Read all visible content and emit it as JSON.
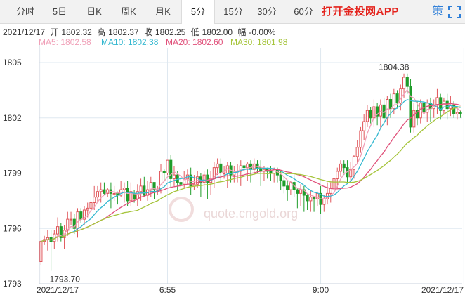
{
  "tabs": [
    {
      "label": "分时",
      "active": false
    },
    {
      "label": "5日",
      "active": false
    },
    {
      "label": "日K",
      "active": false
    },
    {
      "label": "周K",
      "active": false
    },
    {
      "label": "月K",
      "active": false
    },
    {
      "label": "5分",
      "active": true
    },
    {
      "label": "15分",
      "active": false
    },
    {
      "label": "30分",
      "active": false
    },
    {
      "label": "60分",
      "active": false
    }
  ],
  "promo_text": "打开金投网APP",
  "toolbar_icons": [
    "strategy-icon",
    "fullscreen-icon"
  ],
  "toolbar_strategy_label": "策",
  "info": {
    "date": "2021/12/17",
    "open_label": "开",
    "open": "1802.32",
    "high_label": "高",
    "high": "1802.37",
    "close_label": "收",
    "close": "1802.25",
    "low_label": "低",
    "low": "1802.00",
    "change_label": "幅",
    "change": "-0.00%"
  },
  "ma_legend": [
    {
      "label": "MA5: 1802.58",
      "color": "#f0a0b8"
    },
    {
      "label": "MA10: 1802.38",
      "color": "#35b8d0"
    },
    {
      "label": "MA20: 1802.60",
      "color": "#e0507a"
    },
    {
      "label": "MA30: 1801.98",
      "color": "#a5c43a"
    }
  ],
  "watermark": "quote.cngold.org",
  "colors": {
    "up": "#e0555a",
    "down": "#1f9d2a",
    "grid": "#dfe8f0",
    "axis_text": "#333333"
  },
  "chart_data": {
    "type": "candlestick",
    "y_ticks": [
      1793,
      1796,
      1799,
      1802,
      1805
    ],
    "ylim": [
      1793,
      1805.8
    ],
    "x_tick_labels": [
      "2021/12/17",
      "6:55",
      "9:00",
      "2021/12/17"
    ],
    "x_tick_index": [
      0,
      38,
      84,
      127
    ],
    "annotations": [
      {
        "text": "1804.38",
        "index": 109,
        "value": 1804.38
      },
      {
        "text": "1793.70",
        "index": 3,
        "value": 1793.7
      }
    ],
    "candles": [
      [
        1794.2,
        1795.3,
        1794.0,
        1795.4
      ],
      [
        1795.3,
        1795.4,
        1795.1,
        1795.6
      ],
      [
        1795.4,
        1795.5,
        1794.8,
        1795.9
      ],
      [
        1795.5,
        1795.3,
        1793.7,
        1795.9
      ],
      [
        1795.3,
        1795.7,
        1794.9,
        1795.9
      ],
      [
        1795.7,
        1796.1,
        1795.3,
        1796.6
      ],
      [
        1796.1,
        1795.5,
        1795.3,
        1796.3
      ],
      [
        1795.5,
        1795.9,
        1794.9,
        1796.2
      ],
      [
        1795.9,
        1796.5,
        1795.6,
        1796.9
      ],
      [
        1796.5,
        1796.5,
        1796.2,
        1796.9
      ],
      [
        1796.5,
        1796.0,
        1795.7,
        1796.8
      ],
      [
        1796.0,
        1796.9,
        1795.5,
        1797.1
      ],
      [
        1796.9,
        1796.5,
        1796.3,
        1797.1
      ],
      [
        1796.5,
        1797.0,
        1796.2,
        1797.2
      ],
      [
        1797.0,
        1797.1,
        1796.6,
        1797.4
      ],
      [
        1797.1,
        1797.4,
        1796.9,
        1797.7
      ],
      [
        1797.4,
        1797.7,
        1797.0,
        1798.3
      ],
      [
        1797.7,
        1798.0,
        1797.4,
        1798.3
      ],
      [
        1798.0,
        1798.1,
        1797.4,
        1798.5
      ],
      [
        1798.1,
        1797.9,
        1797.8,
        1798.5
      ],
      [
        1797.9,
        1798.1,
        1797.7,
        1798.2
      ],
      [
        1798.1,
        1797.9,
        1797.1,
        1798.5
      ],
      [
        1797.9,
        1797.9,
        1797.5,
        1798.3
      ],
      [
        1797.9,
        1797.8,
        1797.3,
        1798.0
      ],
      [
        1797.8,
        1798.1,
        1797.7,
        1798.6
      ],
      [
        1798.1,
        1798.2,
        1797.4,
        1798.5
      ],
      [
        1798.2,
        1797.5,
        1797.2,
        1798.6
      ],
      [
        1797.5,
        1798.0,
        1797.2,
        1798.5
      ],
      [
        1797.9,
        1797.6,
        1797.4,
        1798.1
      ],
      [
        1797.6,
        1798.0,
        1797.2,
        1798.4
      ],
      [
        1798.0,
        1798.3,
        1797.5,
        1798.7
      ],
      [
        1798.3,
        1797.8,
        1797.7,
        1798.8
      ],
      [
        1797.8,
        1798.1,
        1797.5,
        1798.6
      ],
      [
        1798.1,
        1798.5,
        1797.7,
        1798.8
      ],
      [
        1798.5,
        1798.1,
        1797.6,
        1798.5
      ],
      [
        1798.1,
        1798.1,
        1797.8,
        1798.3
      ],
      [
        1798.1,
        1799.1,
        1797.9,
        1799.5
      ],
      [
        1799.1,
        1799.0,
        1798.6,
        1799.2
      ],
      [
        1799.0,
        1799.7,
        1798.9,
        1799.7
      ],
      [
        1799.7,
        1798.7,
        1798.2,
        1800.0
      ],
      [
        1798.7,
        1798.9,
        1798.3,
        1799.4
      ],
      [
        1798.9,
        1798.5,
        1798.1,
        1799.1
      ],
      [
        1798.5,
        1798.4,
        1798.0,
        1798.8
      ],
      [
        1798.4,
        1798.7,
        1798.2,
        1799.1
      ],
      [
        1798.7,
        1798.9,
        1798.4,
        1799.2
      ],
      [
        1798.9,
        1798.3,
        1797.8,
        1799.3
      ],
      [
        1798.3,
        1798.4,
        1798.1,
        1798.9
      ],
      [
        1798.4,
        1798.8,
        1798.2,
        1799.1
      ],
      [
        1798.8,
        1798.5,
        1797.7,
        1799.0
      ],
      [
        1798.5,
        1798.9,
        1798.1,
        1799.1
      ],
      [
        1798.9,
        1798.5,
        1797.6,
        1799.2
      ],
      [
        1798.5,
        1798.7,
        1797.8,
        1799.1
      ],
      [
        1798.7,
        1799.3,
        1798.2,
        1799.6
      ],
      [
        1799.3,
        1799.5,
        1798.9,
        1799.8
      ],
      [
        1799.5,
        1799.0,
        1798.6,
        1799.8
      ],
      [
        1799.0,
        1799.0,
        1798.7,
        1799.4
      ],
      [
        1799.0,
        1799.4,
        1798.2,
        1799.6
      ],
      [
        1799.4,
        1798.9,
        1798.5,
        1799.6
      ],
      [
        1798.9,
        1799.1,
        1798.5,
        1799.4
      ],
      [
        1799.1,
        1799.1,
        1798.5,
        1799.5
      ],
      [
        1799.1,
        1799.4,
        1798.3,
        1799.7
      ],
      [
        1799.4,
        1799.3,
        1798.8,
        1799.6
      ],
      [
        1799.3,
        1799.5,
        1798.6,
        1799.6
      ],
      [
        1799.5,
        1799.2,
        1798.5,
        1799.7
      ],
      [
        1799.2,
        1799.5,
        1798.9,
        1799.8
      ],
      [
        1799.5,
        1799.3,
        1799.0,
        1799.7
      ],
      [
        1799.3,
        1799.1,
        1798.3,
        1799.7
      ],
      [
        1799.1,
        1799.2,
        1798.6,
        1799.4
      ],
      [
        1799.2,
        1799.1,
        1798.7,
        1799.3
      ],
      [
        1799.1,
        1799.0,
        1798.6,
        1799.4
      ],
      [
        1799.0,
        1799.2,
        1798.5,
        1799.3
      ],
      [
        1799.2,
        1798.9,
        1798.5,
        1799.3
      ],
      [
        1798.9,
        1798.6,
        1798.1,
        1799.1
      ],
      [
        1798.6,
        1798.3,
        1797.9,
        1798.8
      ],
      [
        1798.3,
        1798.1,
        1797.5,
        1798.6
      ],
      [
        1798.1,
        1798.5,
        1797.8,
        1798.6
      ],
      [
        1798.5,
        1798.1,
        1797.7,
        1798.9
      ],
      [
        1798.1,
        1797.9,
        1797.1,
        1798.2
      ],
      [
        1797.9,
        1798.1,
        1797.2,
        1798.4
      ],
      [
        1798.1,
        1797.8,
        1796.9,
        1798.3
      ],
      [
        1797.8,
        1797.5,
        1797.0,
        1797.9
      ],
      [
        1797.5,
        1797.7,
        1796.9,
        1798.1
      ],
      [
        1797.7,
        1797.6,
        1796.9,
        1797.7
      ],
      [
        1797.6,
        1797.9,
        1797.2,
        1798.0
      ],
      [
        1797.9,
        1797.3,
        1796.8,
        1798.3
      ],
      [
        1797.3,
        1797.6,
        1796.9,
        1797.8
      ],
      [
        1797.6,
        1797.9,
        1797.3,
        1798.5
      ],
      [
        1797.9,
        1798.2,
        1797.4,
        1798.5
      ],
      [
        1798.2,
        1798.7,
        1797.8,
        1799.0
      ],
      [
        1798.7,
        1799.1,
        1798.2,
        1799.3
      ],
      [
        1799.1,
        1799.5,
        1798.8,
        1799.7
      ],
      [
        1799.5,
        1799.3,
        1798.9,
        1799.7
      ],
      [
        1799.3,
        1798.8,
        1798.5,
        1799.7
      ],
      [
        1798.8,
        1799.2,
        1798.5,
        1799.6
      ],
      [
        1799.2,
        1799.9,
        1798.7,
        1800.0
      ],
      [
        1799.9,
        1800.4,
        1799.5,
        1800.8
      ],
      [
        1800.4,
        1801.3,
        1800.1,
        1801.5
      ],
      [
        1801.3,
        1801.8,
        1800.8,
        1802.2
      ],
      [
        1801.8,
        1802.4,
        1801.5,
        1802.7
      ],
      [
        1802.4,
        1802.0,
        1801.7,
        1802.6
      ],
      [
        1802.0,
        1802.6,
        1801.5,
        1803.0
      ],
      [
        1802.6,
        1802.1,
        1801.6,
        1802.8
      ],
      [
        1802.1,
        1802.7,
        1801.4,
        1803.0
      ],
      [
        1802.7,
        1802.0,
        1801.7,
        1803.1
      ],
      [
        1802.0,
        1803.0,
        1801.6,
        1803.2
      ],
      [
        1803.0,
        1802.5,
        1802.0,
        1803.3
      ],
      [
        1802.5,
        1803.3,
        1802.2,
        1803.6
      ],
      [
        1803.3,
        1802.8,
        1802.5,
        1803.5
      ],
      [
        1802.8,
        1803.6,
        1802.4,
        1803.8
      ],
      [
        1803.6,
        1804.2,
        1803.1,
        1804.4
      ],
      [
        1804.2,
        1803.7,
        1803.3,
        1804.4
      ],
      [
        1803.7,
        1801.5,
        1801.2,
        1804.1
      ],
      [
        1801.5,
        1802.4,
        1801.2,
        1802.8
      ],
      [
        1802.4,
        1802.0,
        1801.6,
        1802.9
      ],
      [
        1802.0,
        1802.8,
        1801.7,
        1803.0
      ],
      [
        1802.8,
        1802.3,
        1801.9,
        1803.0
      ],
      [
        1802.3,
        1802.8,
        1801.8,
        1803.0
      ],
      [
        1802.8,
        1802.5,
        1801.8,
        1803.1
      ],
      [
        1802.5,
        1802.7,
        1802.0,
        1803.0
      ],
      [
        1802.7,
        1803.1,
        1802.2,
        1803.6
      ],
      [
        1803.1,
        1802.4,
        1801.9,
        1803.3
      ],
      [
        1802.4,
        1802.9,
        1802.2,
        1803.1
      ],
      [
        1802.9,
        1802.5,
        1801.9,
        1803.3
      ],
      [
        1802.5,
        1802.7,
        1802.1,
        1803.2
      ],
      [
        1802.7,
        1802.2,
        1802.0,
        1802.9
      ],
      [
        1802.2,
        1802.3,
        1801.9,
        1802.6
      ],
      [
        1802.3,
        1802.2,
        1802.0,
        1802.4
      ]
    ]
  }
}
